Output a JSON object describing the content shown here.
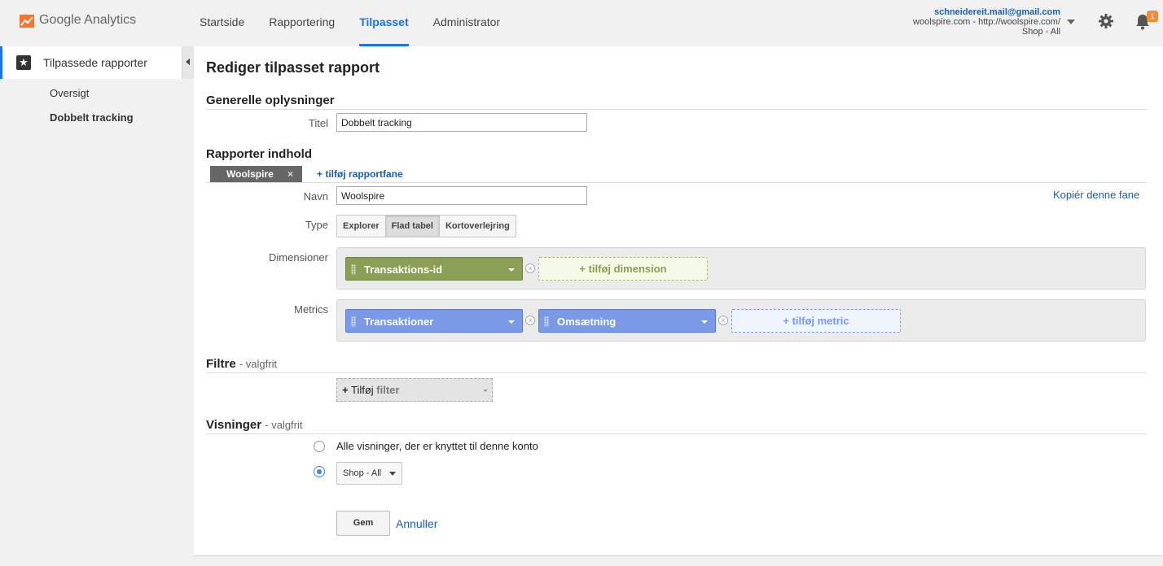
{
  "app": {
    "logo_text": "Google Analytics",
    "logo_icon": "analytics-logo-icon",
    "accent_color": "#1a73e8",
    "logo_color": "#f4772b"
  },
  "nav": {
    "items": [
      {
        "label": "Startside",
        "active": false
      },
      {
        "label": "Rapportering",
        "active": false
      },
      {
        "label": "Tilpasset",
        "active": true
      },
      {
        "label": "Administrator",
        "active": false
      }
    ]
  },
  "account": {
    "email": "schneidereit.mail@gmail.com",
    "property": "woolspire.com - http://woolspire.com/",
    "view": "Shop - All",
    "notifications_count": "1",
    "settings_icon": "gear-icon",
    "notifications_icon": "bell-icon"
  },
  "sidebar": {
    "header_label": "Tilpassede rapporter",
    "header_icon": "star-icon",
    "items": [
      {
        "label": "Oversigt",
        "selected": false
      },
      {
        "label": "Dobbelt tracking",
        "selected": true
      }
    ]
  },
  "editor": {
    "page_title": "Rediger tilpasset rapport",
    "general": {
      "heading": "Generelle oplysninger",
      "title_label": "Titel",
      "title_value": "Dobbelt tracking"
    },
    "content": {
      "heading": "Rapporter indhold",
      "tab_name": "Woolspire",
      "tab_close": "×",
      "add_tab": "+ tilføj rapportfane",
      "copy_tab": "Kopiér denne fane",
      "name_label": "Navn",
      "name_value": "Woolspire",
      "type_label": "Type",
      "type_options": [
        "Explorer",
        "Flad tabel",
        "Kortoverlejring"
      ],
      "type_selected": "Flad tabel",
      "dimensions_label": "Dimensioner",
      "dimensions": [
        "Transaktions-id"
      ],
      "add_dimension": "+ tilføj dimension",
      "metrics_label": "Metrics",
      "metrics": [
        "Transaktioner",
        "Omsætning"
      ],
      "add_metric": "+ tilføj metric",
      "remove_symbol": "×",
      "dimension_color": "#8a9f55",
      "metric_color": "#7a9ae8"
    },
    "filters": {
      "heading": "Filtre",
      "optional": "- valgfrit",
      "add_prefix": "+",
      "add_word": "Tilføj",
      "add_rest": "filter"
    },
    "views": {
      "heading": "Visninger",
      "optional": "- valgfrit",
      "option_all": "Alle visninger, der er knyttet til denne konto",
      "selected_view": "Shop - All"
    },
    "actions": {
      "save": "Gem",
      "cancel": "Annuller"
    }
  }
}
